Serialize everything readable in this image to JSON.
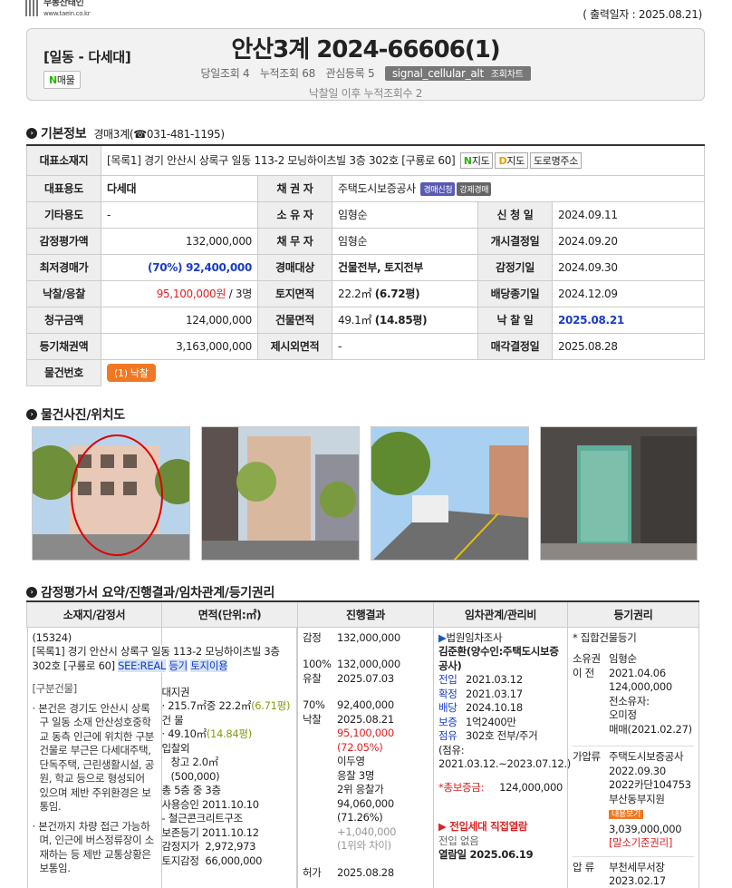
{
  "logo": {
    "name": "부동산태인",
    "url": "www.taein.co.kr"
  },
  "print_date": "( 출력일자 : 2025.08.21)",
  "header": {
    "category": "[일동 - 다세대]",
    "badge_n": "N",
    "badge": "매물",
    "case_no": "안산3계 2024-66606(1)",
    "today_views": "당일조회 4",
    "total_views": "누적조회 68",
    "interest": "관심등록 5",
    "chart_btn": "signal_cellular_alt",
    "chart_label": "조회차트",
    "after_views": "낙찰일 이후 누적조회수 2"
  },
  "basic": {
    "title": "기본정보",
    "court": "경매3계",
    "phone": "(☎031-481-1195)"
  },
  "rows": {
    "addr_h": "대표소재지",
    "addr": "[목록1] 경기 안산시 상록구 일동 113-2 모닝하이츠빌 3층 302호 [구룡로 60]",
    "map_n": "N",
    "map_n_label": "지도",
    "map_d": "D",
    "map_d_label": "지도",
    "road": "도로명주소",
    "use_h": "대표용도",
    "use": "다세대",
    "creditor_h": "채 권 자",
    "creditor": "주택도시보증공사",
    "pill1": "경매신청",
    "pill2": "강제경매",
    "other_h": "기타용도",
    "other": "-",
    "owner_h": "소 유 자",
    "owner": "임형순",
    "apply_h": "신 청 일",
    "apply": "2024.09.11",
    "appr_h": "감정평가액",
    "appr": "132,000,000",
    "debtor_h": "채 무 자",
    "debtor": "임형순",
    "decision_h": "개시결정일",
    "decision": "2024.09.20",
    "min_h": "최저경매가",
    "min": "(70%) 92,400,000",
    "target_h": "경매대상",
    "target": "건물전부, 토지전부",
    "appr_date_h": "감정기일",
    "appr_date": "2024.09.30",
    "bid_h": "낙찰/응찰",
    "bid_amt": "95,100,000원",
    "bid_cnt": " / 3명",
    "land_h": "토지면적",
    "land": "22.2㎡",
    "land_py": "(6.72평)",
    "div_h": "배당종기일",
    "div": "2024.12.09",
    "claim_h": "청구금액",
    "claim": "124,000,000",
    "bldg_h": "건물면적",
    "bldg": "49.1㎡",
    "bldg_py": "(14.85평)",
    "sold_h": "낙 찰 일",
    "sold": "2025.08.21",
    "reg_h": "등기채권액",
    "reg": "3,163,000,000",
    "excl_h": "제시외면적",
    "excl": "-",
    "sale_h": "매각결정일",
    "sale": "2025.08.28",
    "item_h": "물건번호",
    "item_btn": "(1) 낙찰"
  },
  "photos_title": "물건사진/위치도",
  "summary_title": "감정평가서 요약/진행결과/임차관계/등기권리",
  "sum_heads": [
    "소재지/감정서",
    "면적(단위:㎡)",
    "진행결과",
    "임차관계/관리비",
    "등기권리"
  ],
  "c1": {
    "zip": "(15324)",
    "addr": "[목록1] 경기 안산시 상록구 일동 113-2 모닝하이츠빌 3층 302호 [구룡로 60]",
    "links": [
      "SEE:REAL",
      "등기",
      "토지이용"
    ],
    "sub": "[구분건물]",
    "p1": "본건은 경기도 안산시 상록구 일동 소재 안산성호중학교 동측 인근에 위치한 구분건물로 부근은 다세대주택, 단독주택, 근린생활시설, 공원, 학교 등으로 형성되어 있으며 제반 주위환경은 보통임.",
    "p2": "본건까지 차량 접근 가능하며, 인근에 버스정류장이 소재하는 등 제반 교통상황은 보통임."
  },
  "c2": {
    "a": "대지권",
    "b": "· 215.7㎡중 22.2㎡",
    "b2": "(6.71평)",
    "c": "건 물",
    "d": "· 49.10㎡",
    "d2": "(14.84평)",
    "e": "입찰외",
    "f": "창고 2.0㎡",
    "g": "(500,000)",
    "h": "총 5층 중 3층",
    "i": "사용승인 2011.10.10",
    "j": "- 철근콘크리트구조",
    "k": "보존등기 2011.10.12",
    "l": "감정지가",
    "l2": "2,972,973",
    "m": "토지감정",
    "m2": "66,000,000"
  },
  "c3": {
    "r1a": "감정",
    "r1b": "132,000,000",
    "r2a": "100%",
    "r2b": "132,000,000",
    "r3a": "유찰",
    "r3b": "2025.07.03",
    "r4a": "70%",
    "r4b": "92,400,000",
    "r5a": "낙찰",
    "r5b": "2025.08.21",
    "r6": "95,100,000",
    "r7": "(72.05%)",
    "r8": "이두영",
    "r9": "응찰 3명",
    "r10": "2위 응찰가",
    "r11": "94,060,000",
    "r12": "(71.26%)",
    "r13": "+1,040,000",
    "r14": "(1위와 차이)",
    "r15a": "허가",
    "r15b": "2025.08.28"
  },
  "c4": {
    "title": "법원임차조사",
    "name": "김준환(양수인:주택도시보증공사)",
    "k1": "전입",
    "v1": "2021.03.12",
    "k2": "확정",
    "v2": "2021.03.17",
    "k3": "배당",
    "v3": "2024.10.18",
    "k4": "보증",
    "v4": "1억2400만",
    "k5": "점유",
    "v5": "302호 전부/주거",
    "p": "(점유: 2021.03.12.~2023.07.12.)",
    "tot_l": "*총보증금:",
    "tot_v": "124,000,000",
    "t2": "전입세대 직접열람",
    "t3": "전입 없음",
    "t4": "열람일 2025.06.19"
  },
  "c5": {
    "title": "* 집합건물등기",
    "a1": "소유권",
    "a2": "이 전",
    "a3": "임형순",
    "a4": "2021.04.06",
    "a5": "124,000,000",
    "a6": "전소유자:",
    "a7": "오미정",
    "a8": "매매(2021.02.27)",
    "b1": "가압류",
    "b2": "주택도시보증공사",
    "b3": "2022.09.30",
    "b4": "2022카단104753",
    "b5": "부산동부지원",
    "b6": "내용보기",
    "b7": "3,039,000,000",
    "b8": "[말소기준권리]",
    "c1": "압 류",
    "c2": "부천세무서장",
    "c3": "2023.02.17"
  }
}
